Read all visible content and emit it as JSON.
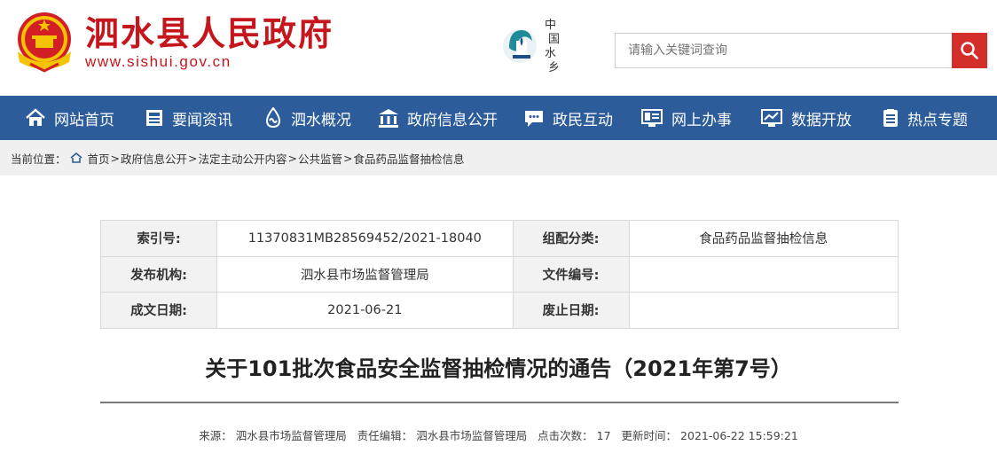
{
  "header": {
    "site_name": "泗水县人民政府",
    "site_url": "www.sishui.gov.cn",
    "context_logo_text": "中国水乡",
    "search_placeholder": "请输入关键词查询",
    "brand_red": "#c4161c",
    "search_btn_color": "#d42e2a"
  },
  "nav": {
    "bg_color": "#2c5c99",
    "items": [
      {
        "label": "网站首页",
        "icon": "home-icon"
      },
      {
        "label": "要闻资讯",
        "icon": "news-icon"
      },
      {
        "label": "泗水概况",
        "icon": "water-icon"
      },
      {
        "label": "政府信息公开",
        "icon": "government-building-icon"
      },
      {
        "label": "政民互动",
        "icon": "chat-icon"
      },
      {
        "label": "网上办事",
        "icon": "online-service-icon"
      },
      {
        "label": "数据开放",
        "icon": "data-chart-icon"
      },
      {
        "label": "热点专题",
        "icon": "topic-list-icon"
      }
    ]
  },
  "breadcrumb": {
    "prefix": "当前位置：",
    "items": [
      "首页",
      "政府信息公开",
      "法定主动公开内容",
      "公共监管",
      "食品药品监督抽检信息"
    ],
    "separator": ">"
  },
  "meta": {
    "rows": [
      {
        "k1": "索引号:",
        "v1": "11370831MB28569452/2021-18040",
        "k2": "组配分类:",
        "v2": "食品药品监督抽检信息"
      },
      {
        "k1": "发布机构:",
        "v1": "泗水县市场监督管理局",
        "k2": "文件编号:",
        "v2": ""
      },
      {
        "k1": "成文日期:",
        "v1": "2021-06-21",
        "k2": "废止日期:",
        "v2": ""
      }
    ]
  },
  "article": {
    "title": "关于101批次食品安全监督抽检情况的通告（2021年第7号）",
    "source_label": "来源：",
    "source": "泗水县市场监督管理局",
    "editor_label": "责任编辑：",
    "editor": "泗水县市场监督管理局",
    "clicks_label": "点击次数：",
    "clicks": "17",
    "updated_label": "更新时间：",
    "updated": "2021-06-22 15:59:21"
  }
}
